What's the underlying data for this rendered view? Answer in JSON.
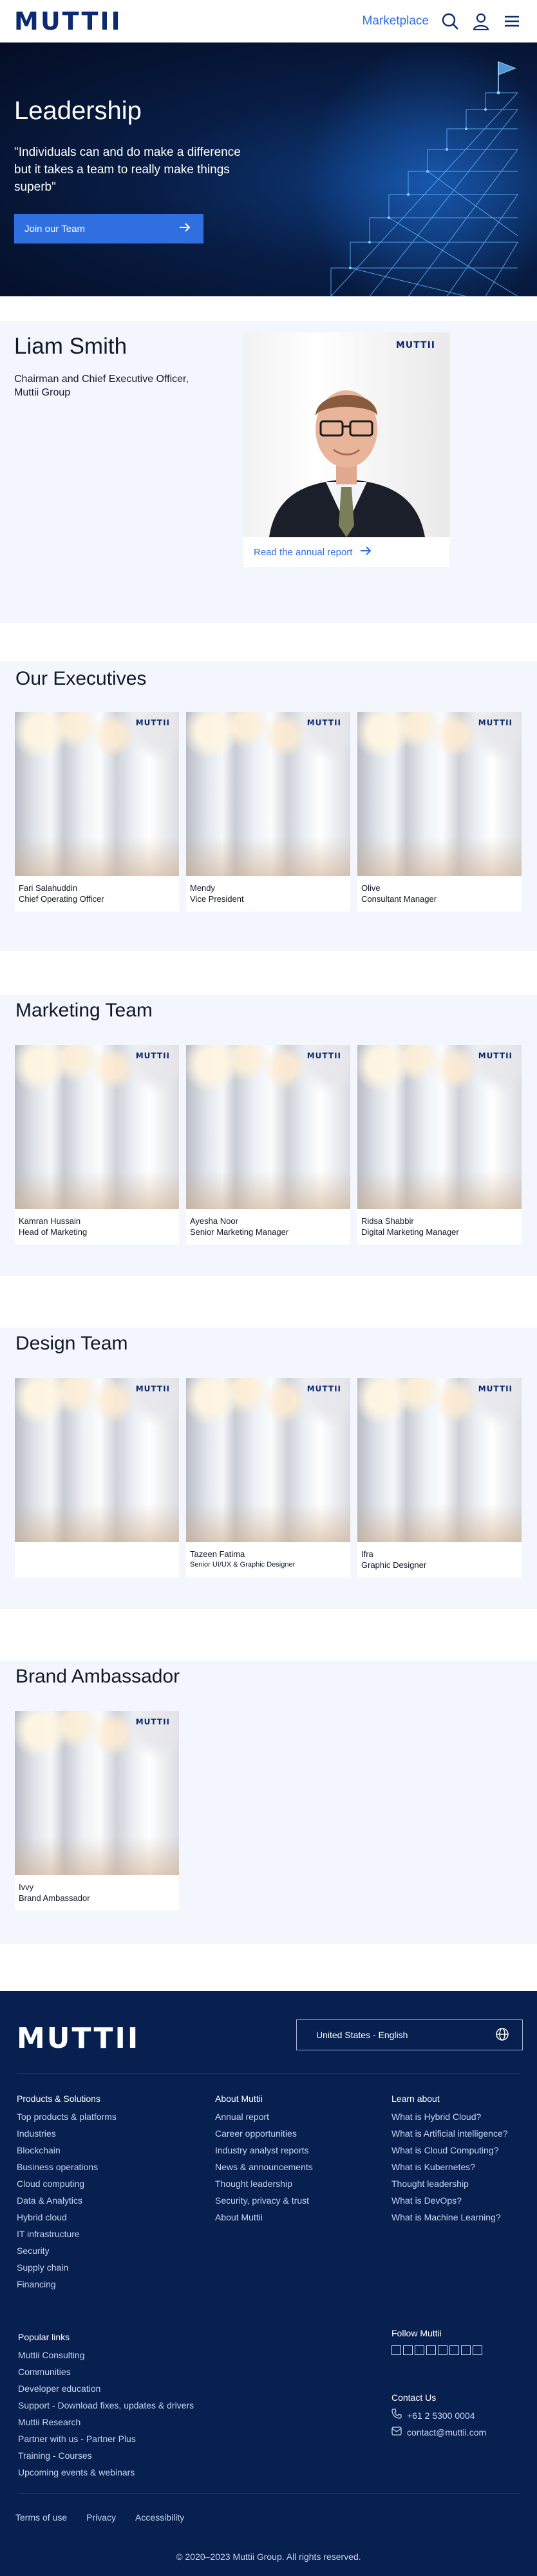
{
  "header": {
    "logo": "MUTTII",
    "marketplace": "Marketplace",
    "icons": [
      "search-icon",
      "user-icon",
      "menu-icon"
    ]
  },
  "hero": {
    "title": "Leadership",
    "quote": "\"Individuals can and do make a difference but it takes a team to really make things superb\"",
    "cta": "Join our Team"
  },
  "leader": {
    "name": "Liam Smith",
    "role": "Chairman and Chief Executive Officer, Muttii Group",
    "photo_logo": "MUTTII",
    "link": "Read the annual report"
  },
  "sections": [
    {
      "title": "Our Executives",
      "members": [
        {
          "name": "Fari Salahuddin",
          "title": "Chief Operating Officer"
        },
        {
          "name": "Mendy",
          "title": "Vice President"
        },
        {
          "name": "Olive",
          "title": "Consultant Manager"
        }
      ]
    },
    {
      "title": "Marketing Team",
      "members": [
        {
          "name": "Kamran Hussain",
          "title": "Head of Marketing"
        },
        {
          "name": "Ayesha Noor",
          "title": "Senior Marketing Manager"
        },
        {
          "name": "Ridsa Shabbir",
          "title": "Digital Marketing Manager"
        }
      ]
    },
    {
      "title": "Design Team",
      "members": [
        {
          "name": "",
          "title": ""
        },
        {
          "name": "Tazeen Fatima",
          "title": "Senior UI/UX & Graphic Designer"
        },
        {
          "name": "Ifra",
          "title": "Graphic Designer"
        }
      ]
    },
    {
      "title": "Brand Ambassador",
      "members": [
        {
          "name": "Ivvy",
          "title": "Brand Ambassador"
        }
      ]
    }
  ],
  "photo_logo": "MUTTII",
  "footer": {
    "logo": "MUTTII",
    "language": "United States - English",
    "col1": {
      "heading": "Products & Solutions",
      "links": [
        "Top products & platforms",
        "Industries",
        "Blockchain",
        "Business operations",
        "Cloud computing",
        "Data & Analytics",
        "Hybrid cloud",
        "IT infrastructure",
        "Security",
        "Supply chain",
        "Financing"
      ]
    },
    "col2": {
      "heading": "About Muttii",
      "links": [
        "Annual report",
        "Career opportunities",
        "Industry analyst reports",
        "News & announcements",
        "Thought leadership",
        "Security, privacy & trust",
        "About Muttii"
      ]
    },
    "col3": {
      "heading": "Learn about",
      "links": [
        "What is Hybrid Cloud?",
        "What is Artificial intelligence?",
        "What is Cloud Computing?",
        "What is Kubernetes?",
        "Thought leadership",
        "What is DevOps?",
        "What is Machine Learning?"
      ]
    },
    "popular": {
      "heading": "Popular links",
      "links": [
        "Muttii Consulting",
        "Communities",
        "Developer education",
        "Support - Download fixes, updates & drivers",
        "Muttii Research",
        "Partner with us - Partner Plus",
        "Training - Courses",
        "Upcoming events & webinars"
      ]
    },
    "follow_heading": "Follow Muttii",
    "social_icons": [
      "linkedin-icon",
      "facebook-icon",
      "instagram-icon",
      "twitter-icon",
      "youtube-icon",
      "podcast-icon",
      "rss-icon",
      "other-icon"
    ],
    "contact": {
      "heading": "Contact Us",
      "phone": "+61 2 5300 0004",
      "email": "contact@muttii.com"
    },
    "legal": [
      "Terms of use",
      "Privacy",
      "Accessibility"
    ],
    "copyright": "© 2020–2023 Muttii Group. All rights reserved."
  },
  "colors": {
    "brand_navy": "#0b2a6f",
    "accent_blue": "#2f6fe0",
    "section_bg": "#f3f6fc",
    "footer_bg": "#08204f"
  }
}
